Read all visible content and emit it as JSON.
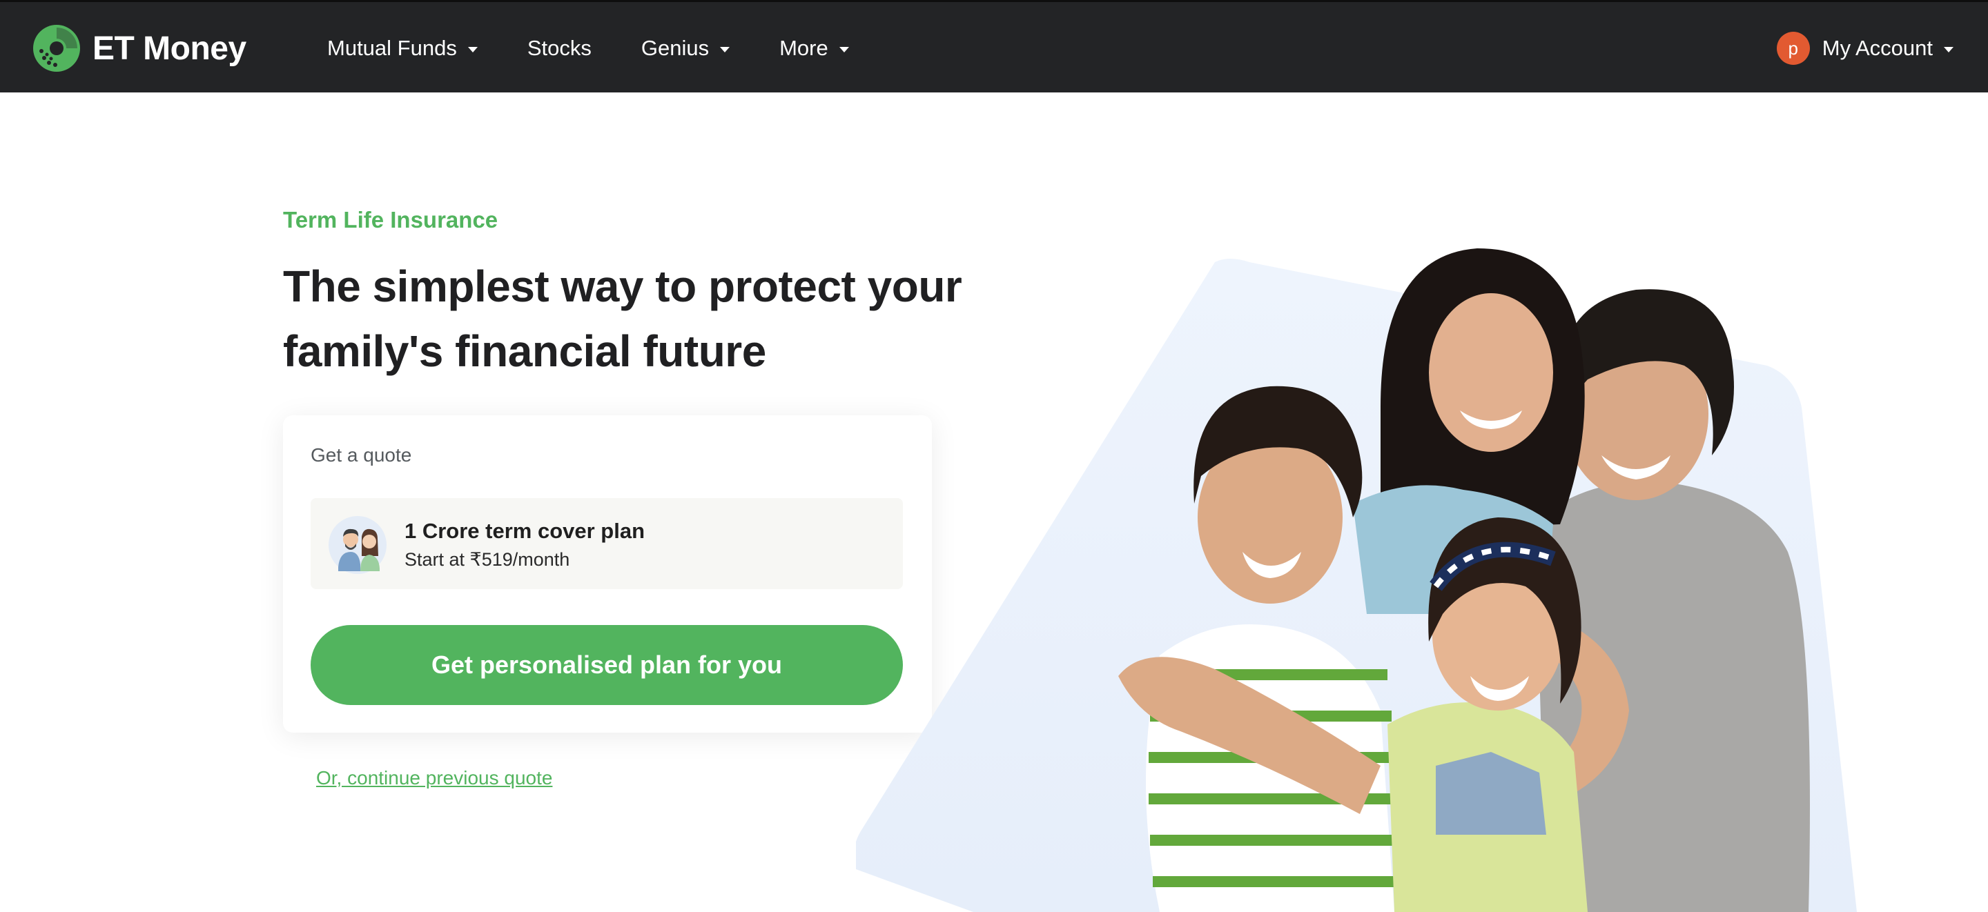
{
  "header": {
    "brand": "ET Money",
    "nav": [
      {
        "label": "Mutual Funds",
        "dropdown": true
      },
      {
        "label": "Stocks",
        "dropdown": false
      },
      {
        "label": "Genius",
        "dropdown": true
      },
      {
        "label": "More",
        "dropdown": true
      }
    ],
    "account": {
      "avatar_initial": "p",
      "label": "My Account"
    }
  },
  "hero": {
    "eyebrow": "Term Life Insurance",
    "headline": "The simplest way to protect your family's financial future",
    "quote_card": {
      "title": "Get a quote",
      "plan_name": "1 Crore term cover plan",
      "plan_price": "Start at ₹519/month",
      "cta": "Get personalised plan for you"
    },
    "secondary_link": "Or, continue previous quote"
  },
  "colors": {
    "navbar": "#232426",
    "accent_green": "#52b45e",
    "avatar": "#e25a31",
    "art_backdrop": "#ebf2fc"
  },
  "icons": {
    "logo": "et-money-logo",
    "caret": "caret-down-icon",
    "plan": "family-couple-icon"
  }
}
